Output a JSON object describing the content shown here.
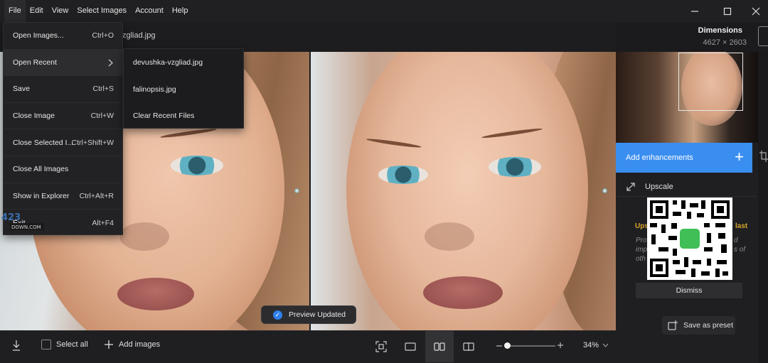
{
  "menubar": {
    "items": [
      "File",
      "Edit",
      "View",
      "Select Images",
      "Account",
      "Help"
    ]
  },
  "header": {
    "filename": "zgliad.jpg",
    "dimensions_label": "Dimensions",
    "dimensions_value": "4627 × 2603"
  },
  "file_menu": {
    "items": [
      {
        "label": "Open Images...",
        "shortcut": "Ctrl+O"
      },
      {
        "label": "Open Recent",
        "shortcut": ""
      },
      {
        "label": "Save",
        "shortcut": "Ctrl+S"
      },
      {
        "label": "Close Image",
        "shortcut": "Ctrl+W"
      },
      {
        "label": "Close Selected I...",
        "shortcut": "Ctrl+Shift+W"
      },
      {
        "label": "Close All Images",
        "shortcut": ""
      },
      {
        "label": "Show in Explorer",
        "shortcut": "Ctrl+Alt+R"
      },
      {
        "label": "Exit",
        "shortcut": "Alt+F4"
      }
    ]
  },
  "recent_menu": {
    "items": [
      "devushka-vzgliad.jpg",
      "falinopsis.jpg",
      "Clear Recent Files"
    ]
  },
  "toast": {
    "text": "Preview Updated"
  },
  "bottombar": {
    "select_all": "Select all",
    "add_images": "Add images",
    "zoom": "34%",
    "zoom_level": 0.03
  },
  "sidebar": {
    "enhance_label": "Add enhancements",
    "upscale_label": "Upscale",
    "promo_head_left": "Ups",
    "promo_head_right": "last",
    "promo_body": [
      "Pro",
      "imp",
      "oth"
    ],
    "promo_body_right": [
      "d",
      "s of"
    ],
    "dismiss": "Dismiss",
    "save_preset": "Save as preset"
  },
  "colors": {
    "accent": "#3a8ef0",
    "promo": "#d6a62b"
  }
}
